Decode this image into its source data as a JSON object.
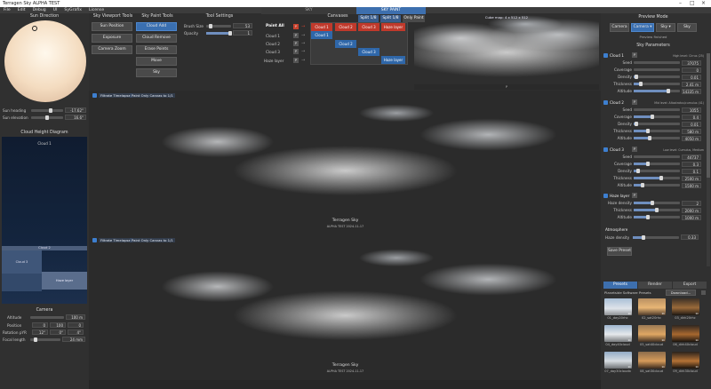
{
  "window": {
    "title": "Terragen Sky ALPHA TEST"
  },
  "menu": [
    "File",
    "Edit",
    "Debug",
    "UI",
    "SyGrafix",
    "License"
  ],
  "sun_direction": {
    "title": "Sun Direction",
    "heading_label": "Sun heading",
    "heading_value": "-17.62°",
    "elevation_label": "Sun elevation",
    "elevation_value": "16.6°"
  },
  "cloud_height": {
    "title": "Cloud Height Diagram",
    "cloud1": "Cloud 1",
    "cloud2": "Cloud 2",
    "cloud3": "Cloud 3",
    "haze": "Haze layer"
  },
  "camera": {
    "title": "Camera",
    "altitude_label": "Altitude",
    "altitude_value": "100 m",
    "position_label": "Position",
    "pos_x": "0",
    "pos_y": "100",
    "pos_z": "0",
    "rotation_label": "Rotation pYR",
    "rot_p": "12°",
    "rot_y": "0°",
    "rot_r": "4°",
    "focal_label": "Focal length",
    "focal_value": "24 mm"
  },
  "viewport_tools": {
    "title": "Sky Viewport Tools",
    "buttons": [
      "Sun Position",
      "Exposure",
      "Camera Zoom"
    ]
  },
  "paint_tools": {
    "title": "Sky Paint Tools",
    "buttons": [
      "Cloud Add",
      "Cloud Remove",
      "Erase Points",
      "Move",
      "Sky"
    ]
  },
  "tool_settings": {
    "title": "Tool Settings",
    "brush_label": "Brush Size",
    "brush_value": "53",
    "opacity_label": "Opacity",
    "opacity_value": "1"
  },
  "top_tabs": {
    "sky": "SKY",
    "sky_paint": "SKY PAINT"
  },
  "canvases": {
    "paint_all": "Paint All",
    "title": "Canvases",
    "split1": "Split 1/8",
    "split2": "Split 1/8",
    "only_paint": "Only Paint",
    "rows": [
      "Cloud 1",
      "Cloud 2",
      "Cloud 3",
      "Haze layer"
    ],
    "p_label": "P",
    "arrow": "→",
    "cells": [
      "Cloud 1",
      "Cloud 2",
      "Cloud 3",
      "Haze layer",
      "Cloud 1",
      "Cloud 2",
      "Cloud 3",
      "Haze layer"
    ]
  },
  "cubemap": {
    "label": "Cube map: 4 x 512 x 512",
    "footer": "P"
  },
  "viewport1": {
    "tag1": "Filtrate Timelapse",
    "tag2": "Paint Only Canvas to 1/1",
    "watermark": "Terragen Sky",
    "sub": "ALPHA TEST 2024-11-17"
  },
  "viewport2": {
    "tag1": "Filtrate Timelapse",
    "tag2": "Paint Only Canvas to 1/1",
    "watermark": "Terragen Sky",
    "sub": "ALPHA TEST 2024-11-17"
  },
  "preview_mode": {
    "title": "Preview Mode",
    "camera": "Camera",
    "camera_select": "Camera ▾",
    "sky_select": "Sky ▾",
    "sky": "Sky",
    "status": "Preview finished"
  },
  "sky_params": {
    "title": "Sky Parameters",
    "p_label": "P",
    "cloud1": {
      "name": "Cloud 1",
      "type": "High level: Cirrus (25)",
      "rows": [
        {
          "label": "Seed",
          "value": "37075",
          "fill": 0
        },
        {
          "label": "Coverage",
          "value": "0",
          "fill": 0
        },
        {
          "label": "Density",
          "value": "0.01",
          "fill": 0.05
        },
        {
          "label": "Thickness",
          "value": "2.41 m",
          "fill": 0.15
        },
        {
          "label": "Altitude",
          "value": "14335 m",
          "fill": 0.75
        }
      ]
    },
    "cloud2": {
      "name": "Cloud 2",
      "type": "Mid level: Altostratus/cumulus (41)",
      "rows": [
        {
          "label": "Seed",
          "value": "1055",
          "fill": 0
        },
        {
          "label": "Coverage",
          "value": "0.4",
          "fill": 0.4
        },
        {
          "label": "Density",
          "value": "0.01",
          "fill": 0.05
        },
        {
          "label": "Thickness",
          "value": "580 m",
          "fill": 0.3
        },
        {
          "label": "Altitude",
          "value": "4050 m",
          "fill": 0.35
        }
      ]
    },
    "cloud3": {
      "name": "Cloud 3",
      "type": "Low level: Cumulus, Medium",
      "rows": [
        {
          "label": "Seed",
          "value": "44737",
          "fill": 0
        },
        {
          "label": "Coverage",
          "value": "0.3",
          "fill": 0.3
        },
        {
          "label": "Density",
          "value": "0.1",
          "fill": 0.1
        },
        {
          "label": "Thickness",
          "value": "2500 m",
          "fill": 0.6
        },
        {
          "label": "Altitude",
          "value": "1500 m",
          "fill": 0.2
        }
      ]
    },
    "haze": {
      "name": "Haze layer",
      "rows": [
        {
          "label": "Haze density",
          "value": "2",
          "fill": 0.4
        },
        {
          "label": "Thickness",
          "value": "2000 m",
          "fill": 0.5
        },
        {
          "label": "Altitude",
          "value": "1000 m",
          "fill": 0.3
        }
      ]
    },
    "atmosphere_title": "Atmosphere",
    "atmo_haze_label": "Haze density",
    "atmo_haze_value": "0.33",
    "save_preset": "Save Preset"
  },
  "presets": {
    "tabs": [
      "Presets",
      "Render",
      "Export"
    ],
    "source": "Planetside Software Presets",
    "download": "Download...",
    "items": [
      {
        "name": "01_day20rhc",
        "res": "1k"
      },
      {
        "name": "02_sat20rhc",
        "res": "1k"
      },
      {
        "name": "03_dirk20rhc",
        "res": "1k"
      },
      {
        "name": "04_day40cloud",
        "res": "1k"
      },
      {
        "name": "05_sat40cloud",
        "res": "1k"
      },
      {
        "name": "06_dirk40cloud",
        "res": "1k"
      },
      {
        "name": "07_day30cloudb",
        "res": "1k"
      },
      {
        "name": "08_sat30cloud",
        "res": "1k"
      },
      {
        "name": "09_dirk30cloud",
        "res": "1k"
      }
    ]
  }
}
